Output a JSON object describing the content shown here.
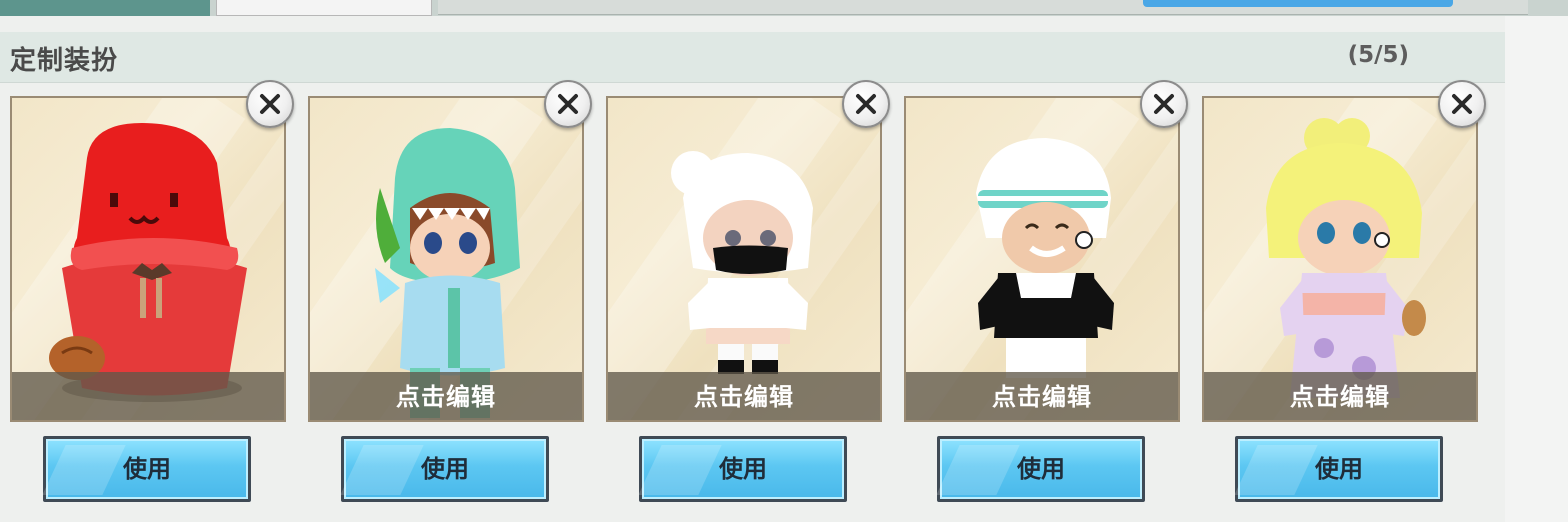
{
  "header": {
    "title": "定制装扮",
    "count": "(5/5)"
  },
  "cards": [
    {
      "character": "red-hooded-avatar",
      "edit_label": "",
      "use_label": "使用"
    },
    {
      "character": "shark-costume-avatar",
      "edit_label": "点击编辑",
      "use_label": "使用"
    },
    {
      "character": "white-hair-masked-avatar",
      "edit_label": "点击编辑",
      "use_label": "使用"
    },
    {
      "character": "headband-black-jacket-avatar",
      "edit_label": "点击编辑",
      "use_label": "使用"
    },
    {
      "character": "yellow-hair-kimono-avatar",
      "edit_label": "点击编辑",
      "use_label": "使用"
    }
  ],
  "colors": {
    "button_blue": "#5cc7f2",
    "card_bg": "#f2e6c8",
    "header_bg": "#dfe8e4"
  },
  "icons": {
    "close": "close-icon"
  }
}
